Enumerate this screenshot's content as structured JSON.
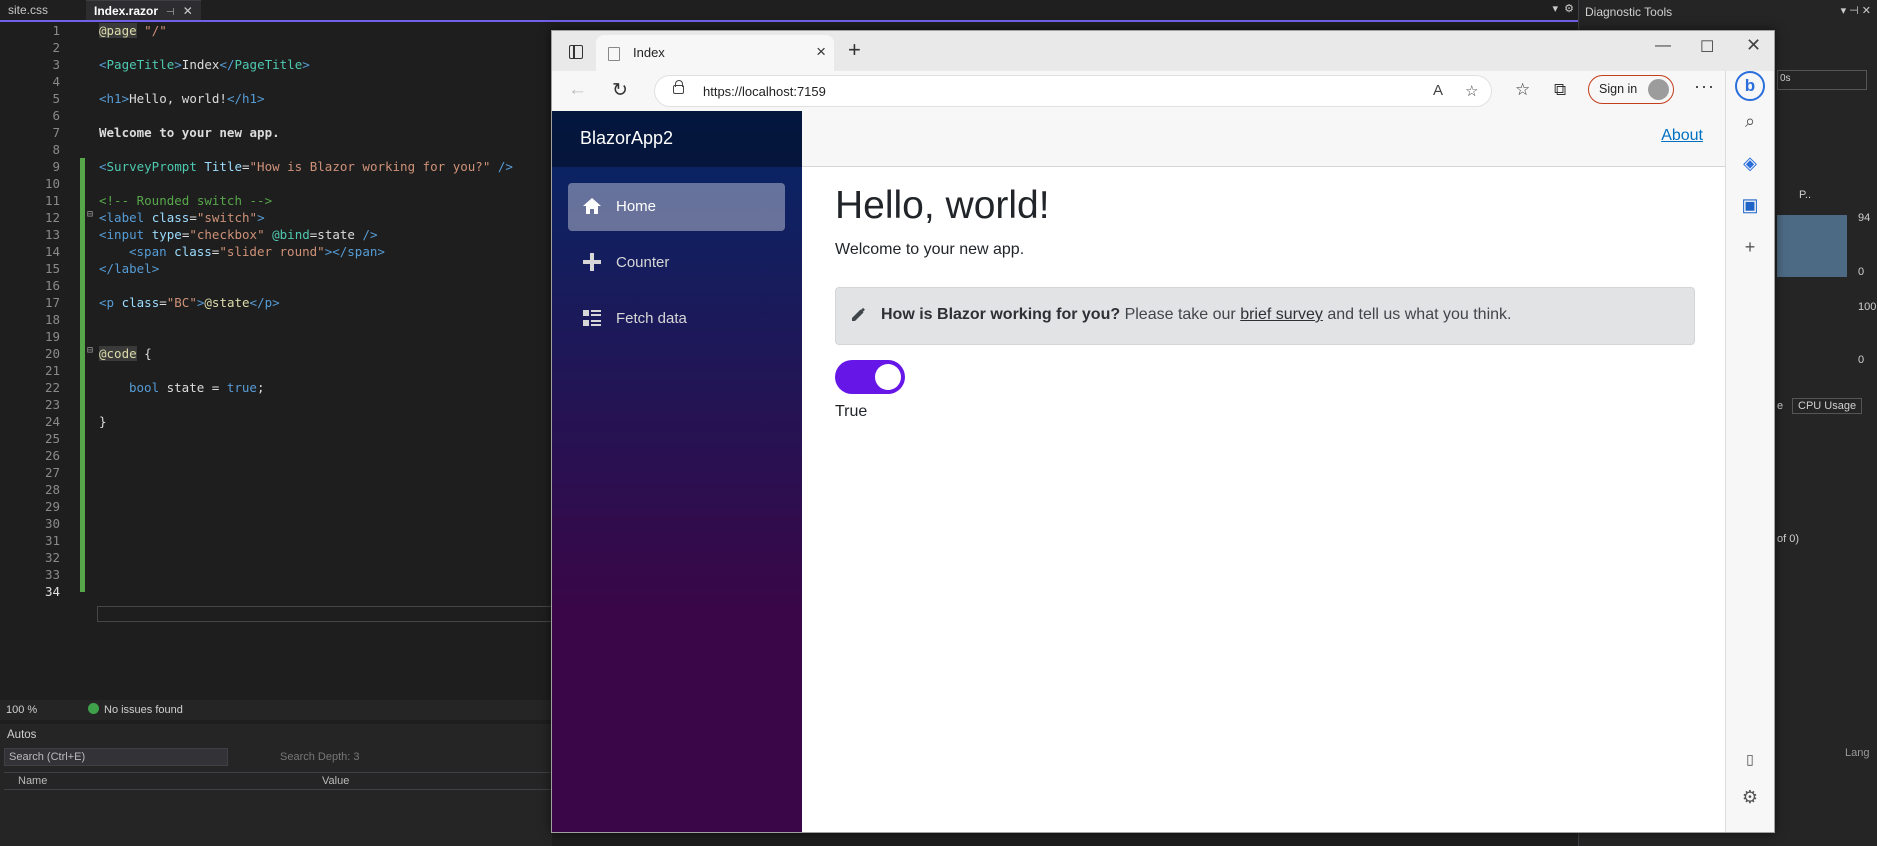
{
  "vs": {
    "tabs": [
      {
        "label": "site.css"
      },
      {
        "label": "Index.razor"
      }
    ],
    "code_lines": [
      {
        "n": "1"
      },
      {
        "n": "2"
      },
      {
        "n": "3"
      },
      {
        "n": "4"
      },
      {
        "n": "5"
      },
      {
        "n": "6"
      },
      {
        "n": "7"
      },
      {
        "n": "8"
      },
      {
        "n": "9"
      },
      {
        "n": "10"
      },
      {
        "n": "11"
      },
      {
        "n": "12"
      },
      {
        "n": "13"
      },
      {
        "n": "14"
      },
      {
        "n": "15"
      },
      {
        "n": "16"
      },
      {
        "n": "17"
      },
      {
        "n": "18"
      },
      {
        "n": "19"
      },
      {
        "n": "20"
      },
      {
        "n": "21"
      },
      {
        "n": "22"
      },
      {
        "n": "23"
      },
      {
        "n": "24"
      },
      {
        "n": "25"
      },
      {
        "n": "26"
      },
      {
        "n": "27"
      },
      {
        "n": "28"
      },
      {
        "n": "29"
      },
      {
        "n": "30"
      },
      {
        "n": "31"
      },
      {
        "n": "32"
      },
      {
        "n": "33"
      },
      {
        "n": "34"
      }
    ],
    "code": {
      "l1_dir": "@page",
      "l1_rest": " \"/\"",
      "l3_open": "<",
      "l3_tag": "PageTitle",
      "l3_gt": ">",
      "l3_txt": "Index",
      "l3_close_lt": "</",
      "l3_tag2": "PageTitle",
      "l3_close_gt": ">",
      "l5_h1o": "<h1>",
      "l5_txt": "Hello, world!",
      "l5_h1c": "</h1>",
      "l7_txt": "Welcome to your new app.",
      "l9_lt": "<",
      "l9_comp": "SurveyPrompt",
      "l9_attr": " Title",
      "l9_eq": "=",
      "l9_str": "\"How is Blazor working for you?\"",
      "l9_end": " />",
      "l11": "<!-- Rounded switch -->",
      "l12_lt": "<",
      "l12_tag": "label",
      "l12_attr": " class",
      "l12_eq": "=",
      "l12_str": "\"switch\"",
      "l12_gt": ">",
      "l13_lt": "<",
      "l13_tag": "input",
      "l13_attr": " type",
      "l13_eq": "=",
      "l13_str": "\"checkbox\"",
      "l13_bind": " @bind",
      "l13_eq2": "=",
      "l13_val": "state",
      "l13_end": " />",
      "l14_lt": "<",
      "l14_tag": "span",
      "l14_attr": " class",
      "l14_eq": "=",
      "l14_str": "\"slider round\"",
      "l14_gt": "></",
      "l14_tag2": "span",
      "l14_gt2": ">",
      "l15_lt": "</",
      "l15_tag": "label",
      "l15_gt": ">",
      "l17_lt": "<",
      "l17_tag": "p",
      "l17_attr": " class",
      "l17_eq": "=",
      "l17_str": "\"BC\"",
      "l17_gt": ">",
      "l17_at": "@state",
      "l17_close": "</p>",
      "l20_dir": "@code",
      "l20_brace": " {",
      "l22_kw": "bool",
      "l22_mid": " state = ",
      "l22_val": "true",
      "l22_semi": ";",
      "l24": "}"
    },
    "status": {
      "zoom": "100 %",
      "issues": "No issues found"
    },
    "autos": {
      "title": "Autos",
      "search_placeholder": "Search (Ctrl+E)",
      "depth_label": "Search Depth:",
      "depth_value": "3",
      "col_name": "Name",
      "col_value": "Value"
    },
    "diagnostic": {
      "title": "Diagnostic Tools",
      "time_label": "0s",
      "mem_max": "94",
      "mem_min": "0",
      "cpu_max": "100",
      "cpu_min": "0",
      "tab_cpu": "CPU Usage",
      "tab_e": "e",
      "events": "of 0)",
      "lang": "Lang",
      "legend_p": "P.."
    }
  },
  "browser": {
    "tab_title": "Index",
    "url": "https://localhost:7159",
    "signin": "Sign in"
  },
  "app": {
    "brand": "BlazorApp2",
    "nav": [
      {
        "label": "Home",
        "icon": "home-icon",
        "active": true
      },
      {
        "label": "Counter",
        "icon": "plus-icon",
        "active": false
      },
      {
        "label": "Fetch data",
        "icon": "list-icon",
        "active": false
      }
    ],
    "about": "About",
    "heading": "Hello, world!",
    "welcome": "Welcome to your new app.",
    "survey": {
      "question": "How is Blazor working for you?",
      "before_link": " Please take our ",
      "link": "brief survey",
      "after_link": " and tell us what you think."
    },
    "switch_on": true,
    "state_text": "True",
    "colors": {
      "switch": "#6617e8",
      "nav_top": "#052767",
      "nav_bottom": "#3a0647",
      "link": "#0071c1"
    }
  }
}
